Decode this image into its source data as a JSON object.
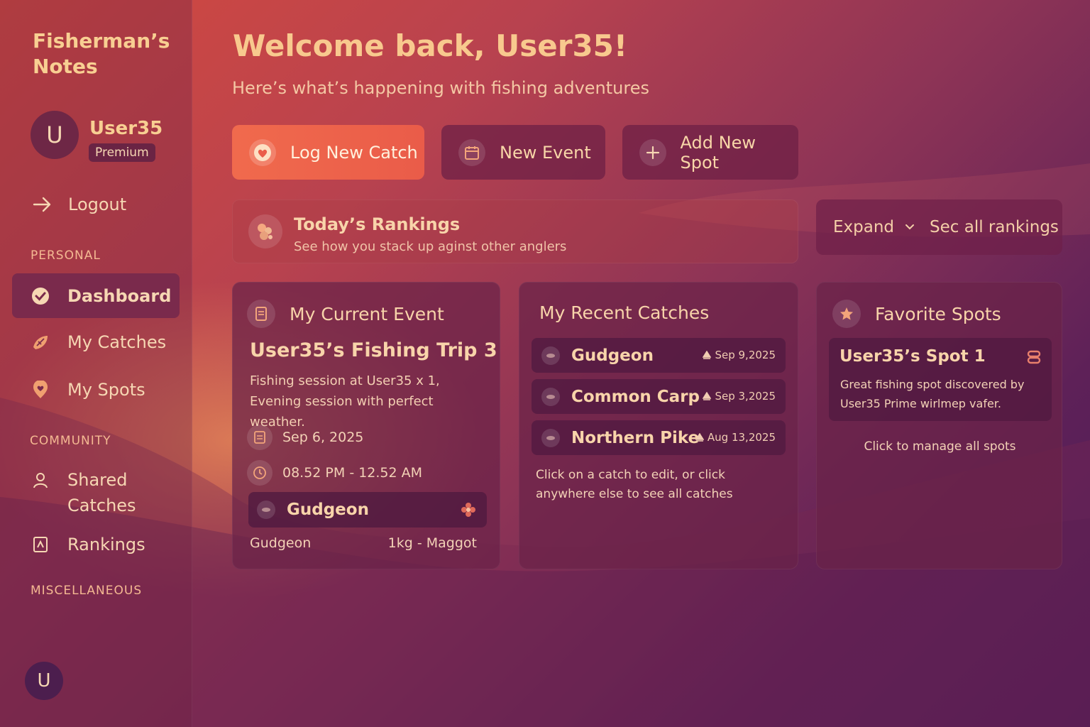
{
  "app": {
    "brand": "Fisherman’s Notes"
  },
  "user": {
    "initial": "U",
    "name": "User35",
    "badge": "Premium"
  },
  "sidebar": {
    "logout": "Logout",
    "sections": {
      "personal": "PERSONAL",
      "community": "COMMUNITY",
      "misc": "MISCELLANEOUS"
    },
    "items": [
      {
        "label": "Dashboard",
        "icon": "dashboard-icon"
      },
      {
        "label": "My Catches",
        "icon": "fish-icon"
      },
      {
        "label": "My Spots",
        "icon": "heart-pin-icon"
      },
      {
        "label": "Shared Catches",
        "icon": "user-icon"
      },
      {
        "label": "Rankings",
        "icon": "trophy-icon"
      }
    ]
  },
  "header": {
    "welcome": "Welcome back, User35!",
    "subtitle": "Here’s what’s happening with fishing adventures"
  },
  "actions": {
    "log_catch": "Log New Catch",
    "new_event": "New Event",
    "add_spot": "Add New Spot"
  },
  "rankings": {
    "title": "Today’s Rankings",
    "subtitle": "See how you stack up aginst other anglers",
    "expand": "Expand",
    "see_all": "Sec all rankings"
  },
  "current_event": {
    "heading": "My Current Event",
    "title": "User35’s Fishing Trip 3",
    "description": "Fishing session at User35 x 1, Evening session with perfect weather.",
    "date": "Sep 6, 2025",
    "time": "08.52 PM - 12.52 AM",
    "catch_name": "Gudgeon",
    "foot_species": "Gudgeon",
    "foot_detail": "1kg - Maggot"
  },
  "recent_catches": {
    "heading": "My Recent Catches",
    "items": [
      {
        "name": "Gudgeon",
        "date": "Sep 9,2025"
      },
      {
        "name": "Common Carp",
        "date": "Sep 3,2025"
      },
      {
        "name": "Northern Pike",
        "date": "Aug 13,2025"
      }
    ],
    "hint": "Click on a catch to edit, or click anywhere else to see all catches"
  },
  "favorite_spots": {
    "heading": "Favorite Spots",
    "spot_title": "User35’s Spot 1",
    "spot_desc": "Great fishing spot discovered by User35 Prime wirlmep vafer.",
    "manage": "Click to manage all spots"
  },
  "colors": {
    "accent": "#f06a4d",
    "title": "#f8c98e",
    "panel": "#6e2246"
  }
}
